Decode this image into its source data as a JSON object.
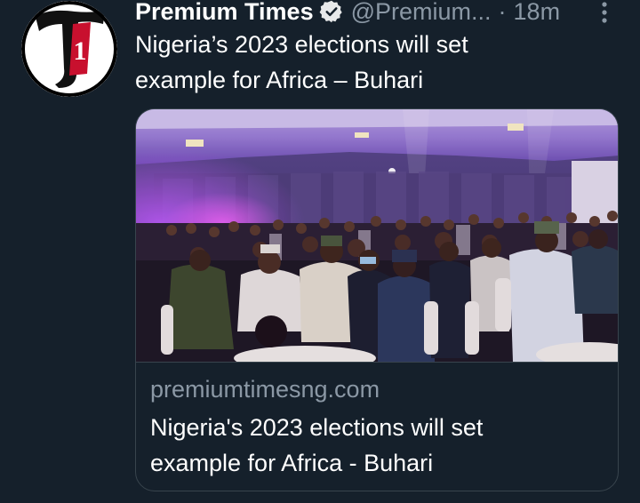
{
  "tweet": {
    "author_name": "Premium Times",
    "handle": "@Premium...",
    "separator": "·",
    "time": "18m",
    "text": "Nigeria’s 2023 elections will set example for Africa – Buhari",
    "verified_icon": "verified-badge-icon",
    "more_icon": "more-vertical-icon",
    "avatar_letter": "1"
  },
  "card": {
    "image_alt": "Event hall with attendees standing",
    "domain": "premiumtimesng.com",
    "title": "Nigeria's 2023 elections will set example for Africa - Buhari"
  },
  "colors": {
    "background": "#15202b",
    "secondary_text": "#8b98a5",
    "border": "#38444d",
    "logo_red": "#c8102e"
  }
}
